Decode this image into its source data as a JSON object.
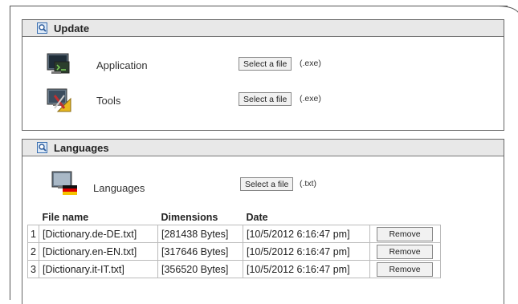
{
  "update": {
    "title": "Update",
    "items": [
      {
        "label": "Application",
        "button": "Select a file",
        "ext": "(.exe)"
      },
      {
        "label": "Tools",
        "button": "Select a file",
        "ext": "(.exe)"
      }
    ]
  },
  "languages": {
    "title": "Languages",
    "item": {
      "label": "Languages",
      "button": "Select a file",
      "ext": "(.txt)"
    },
    "table": {
      "headers": [
        "File name",
        "Dimensions",
        "Date"
      ],
      "rows": [
        {
          "num": "1",
          "file": "[Dictionary.de-DE.txt]",
          "size": "[281438 Bytes]",
          "date": "[10/5/2012 6:16:47 pm]",
          "action": "Remove"
        },
        {
          "num": "2",
          "file": "[Dictionary.en-EN.txt]",
          "size": "[317646 Bytes]",
          "date": "[10/5/2012 6:16:47 pm]",
          "action": "Remove"
        },
        {
          "num": "3",
          "file": "[Dictionary.it-IT.txt]",
          "size": "[356520 Bytes]",
          "date": "[10/5/2012 6:16:47 pm]",
          "action": "Remove"
        }
      ]
    }
  }
}
